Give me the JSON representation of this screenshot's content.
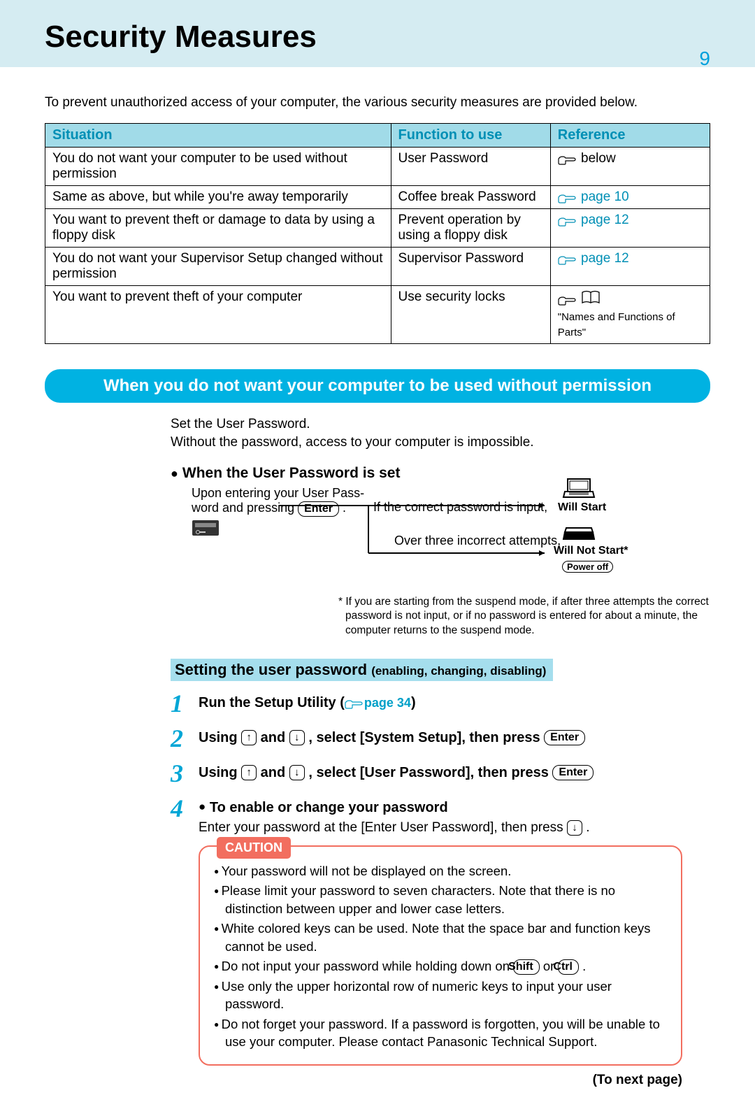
{
  "header": {
    "title": "Security Measures",
    "page_number": "9"
  },
  "intro": "To prevent unauthorized access of your computer, the various security measures are provided below.",
  "table": {
    "headers": {
      "situation": "Situation",
      "function": "Function to use",
      "reference": "Reference"
    },
    "rows": [
      {
        "situation": "You do not want your computer to be used without permission",
        "function": "User Password",
        "reference": "below"
      },
      {
        "situation": "Same as above, but while you're away temporarily",
        "function": "Coffee break Password",
        "reference": "page 10"
      },
      {
        "situation": "You want to prevent theft or damage to data by using a floppy disk",
        "function": "Prevent operation by using a floppy disk",
        "reference": "page 12"
      },
      {
        "situation": "You do not want your Supervisor Setup changed without permission",
        "function": "Supervisor Password",
        "reference": "page 12"
      },
      {
        "situation": "You want to prevent theft of your computer",
        "function": "Use security locks",
        "reference": "\"Names and Functions of Parts\""
      }
    ]
  },
  "section": {
    "banner": "When you do not want your computer to be used without permission",
    "intro1": "Set the User Password.",
    "intro2": "Without the password, access to your computer is impossible.",
    "when_set_heading": "When the User Password is set",
    "diagram": {
      "line1a": "Upon entering your User Pass-",
      "line1b": "word and pressing ",
      "enter": "Enter",
      "dot": " .",
      "correct": "If the correct password is input,",
      "will_start": "Will Start",
      "incorrect": "Over three incorrect attempts,",
      "will_not_start": "Will Not Start*",
      "power_off": "Power off"
    },
    "footnote": "If you are starting from the suspend mode, if after three attempts the correct password is not input, or if no password is entered for about a minute, the computer returns to the suspend mode.",
    "setting_heading": "Setting the user password",
    "setting_sub": "(enabling, changing, disabling)",
    "steps": {
      "s1": {
        "text": "Run the Setup Utility",
        "ref": "page 34"
      },
      "s2": {
        "prefix": "Using ",
        "mid": " and ",
        "tail": " , select [System Setup], then press ",
        "enter": "Enter"
      },
      "s3": {
        "prefix": "Using ",
        "mid": " and ",
        "tail": " , select [User Password], then press ",
        "enter": "Enter"
      },
      "s4": {
        "heading": "To enable or change your password",
        "body": "Enter your password at the [Enter User Password], then press ",
        "dot": " ."
      }
    },
    "caution": {
      "label": "CAUTION",
      "items": [
        "Your password will not be displayed on the screen.",
        "Please limit your password to seven characters.  Note that there is no distinction between upper and lower case letters.",
        "White colored keys can be used.  Note that the space bar and function keys cannot be used.",
        {
          "pre": "Do not input your password while holding down on ",
          "k1": "Shift",
          "mid": " or ",
          "k2": "Ctrl",
          "post": " ."
        },
        "Use only the upper horizontal row of numeric keys to input your user password.",
        "Do not forget your password.  If a password is forgotten, you will be unable to use your computer.  Please contact Panasonic Technical Support."
      ]
    },
    "to_next": "(To next page)"
  }
}
